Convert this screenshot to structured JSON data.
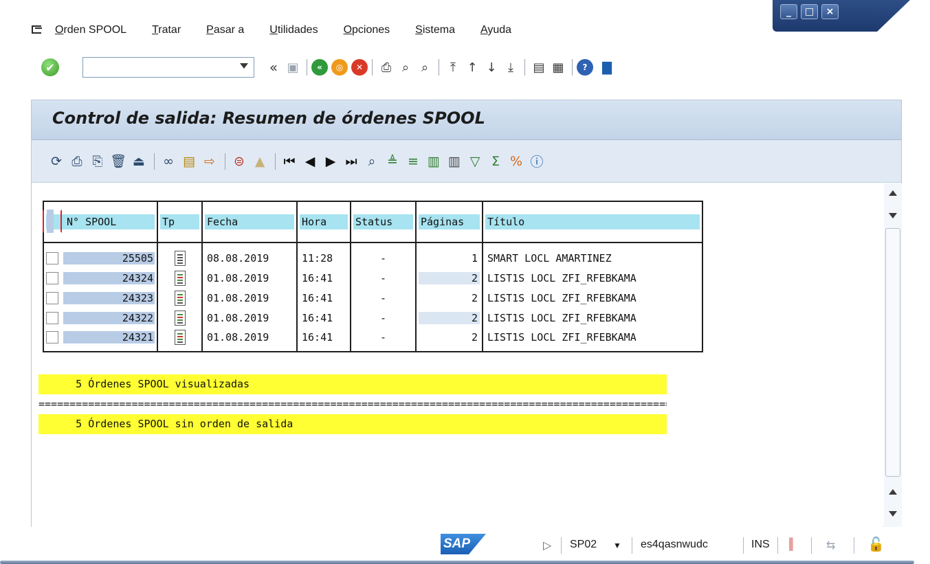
{
  "window": {
    "minimize": "_",
    "maximize": "□",
    "close": "×"
  },
  "menu": [
    {
      "pre": "",
      "ul": "O",
      "post": "rden SPOOL"
    },
    {
      "pre": "",
      "ul": "T",
      "post": "ratar"
    },
    {
      "pre": "",
      "ul": "P",
      "post": "asar a"
    },
    {
      "pre": "",
      "ul": "U",
      "post": "tilidades"
    },
    {
      "pre": "",
      "ul": "O",
      "post": "pciones"
    },
    {
      "pre": "",
      "ul": "S",
      "post": "istema"
    },
    {
      "pre": "",
      "ul": "A",
      "post": "yuda"
    }
  ],
  "toolbar": {
    "command_value": "",
    "icons": [
      "enter-icon",
      "command-dropdown-icon",
      "collapse-icon",
      "save-icon",
      "back-icon",
      "exit-icon",
      "cancel-icon",
      "print-icon",
      "find-icon",
      "find-next-icon",
      "first-page-icon",
      "prev-page-icon",
      "next-page-icon",
      "last-page-icon",
      "new-session-icon",
      "shortcut-icon",
      "help-icon",
      "layout-icon"
    ]
  },
  "page": {
    "title": "Control de salida: Resumen de órdenes SPOOL"
  },
  "app_toolbar": {
    "icons": [
      "refresh-icon",
      "print-directly-icon",
      "print-with-changed-params-icon",
      "delete-icon",
      "send-icon",
      "display-contents-icon",
      "display-in-maximum-icon",
      "forward-icon",
      "output-requests-icon",
      "output-attributes-icon",
      "first-entry-icon",
      "previous-entry-icon",
      "next-entry-icon",
      "last-entry-icon",
      "find-icon",
      "sort-ascending-icon",
      "sort-descending-icon",
      "select-layout-icon",
      "save-layout-icon",
      "filter-icon",
      "total-icon",
      "subtotal-icon",
      "info-icon"
    ]
  },
  "table": {
    "headers": {
      "spool": "N° SPOOL",
      "type": "Tp",
      "date": "Fecha",
      "time": "Hora",
      "status": "Status",
      "pages": "Páginas",
      "title": "Título"
    },
    "rows": [
      {
        "spool": "25505",
        "type": "document-icon",
        "date": "08.08.2019",
        "time": "11:28",
        "status": "-",
        "pages": "1",
        "title": "SMART LOCL AMARTINEZ"
      },
      {
        "spool": "24324",
        "type": "list-icon",
        "date": "01.08.2019",
        "time": "16:41",
        "status": "-",
        "pages": "2",
        "title": "LIST1S LOCL ZFI_RFEBKAMA"
      },
      {
        "spool": "24323",
        "type": "list-icon",
        "date": "01.08.2019",
        "time": "16:41",
        "status": "-",
        "pages": "2",
        "title": "LIST1S LOCL ZFI_RFEBKAMA"
      },
      {
        "spool": "24322",
        "type": "list-icon",
        "date": "01.08.2019",
        "time": "16:41",
        "status": "-",
        "pages": "2",
        "title": "LIST1S LOCL ZFI_RFEBKAMA"
      },
      {
        "spool": "24321",
        "type": "list-icon",
        "date": "01.08.2019",
        "time": "16:41",
        "status": "-",
        "pages": "2",
        "title": "LIST1S LOCL ZFI_RFEBKAMA"
      }
    ]
  },
  "summary": {
    "line1": "      5 Órdenes SPOOL visualizadas",
    "separator": "==========================================================================================================",
    "line2": "      5 Órdenes SPOOL sin orden de salida"
  },
  "status_bar": {
    "logo": "SAP",
    "transaction": "SP02",
    "server": "es4qasnwudc",
    "mode": "INS"
  }
}
